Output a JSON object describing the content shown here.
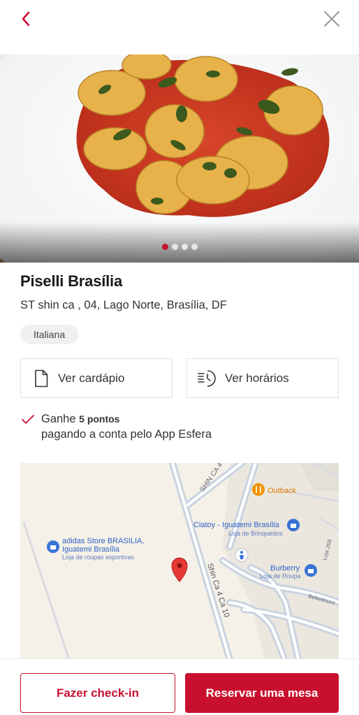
{
  "header": {
    "back_icon": "chevron-left-icon",
    "close_icon": "close-icon"
  },
  "gallery": {
    "image": "pasta-dish-photo",
    "dots": [
      true,
      false,
      false,
      false
    ]
  },
  "restaurant": {
    "name": "Piselli Brasília",
    "address": "ST shin ca , 04, Lago Norte, Brasília, DF",
    "tag": "Italiana"
  },
  "actions": {
    "menu_label": "Ver cardápio",
    "menu_icon": "document-icon",
    "hours_label": "Ver horários",
    "hours_icon": "schedule-icon"
  },
  "points": {
    "prefix": "Ganhe",
    "amount": "5 pontos",
    "suffix": "pagando a conta pelo App Esfera"
  },
  "map": {
    "street_1": "SHIN CA 4",
    "street_2": "Shin Ca 4 Ca 10",
    "street_3": "Loja 268",
    "street_4": "Bebedouro",
    "poi_outback": "Outback",
    "poi_ciatoy": "Ciatoy - Iguatemi Brasília",
    "poi_ciatoy_sub": "Loja de Brinquedos",
    "poi_adidas_1": "adidas Store BRASILIA,",
    "poi_adidas_2": "Iguatemi Brasília",
    "poi_adidas_sub": "Loja de roupas esportivas",
    "poi_burberry": "Burberry",
    "poi_burberry_sub": "Loja de Roupa"
  },
  "footer": {
    "checkin_label": "Fazer check-in",
    "reserve_label": "Reservar uma mesa"
  },
  "colors": {
    "brand_red": "#c8102e"
  }
}
